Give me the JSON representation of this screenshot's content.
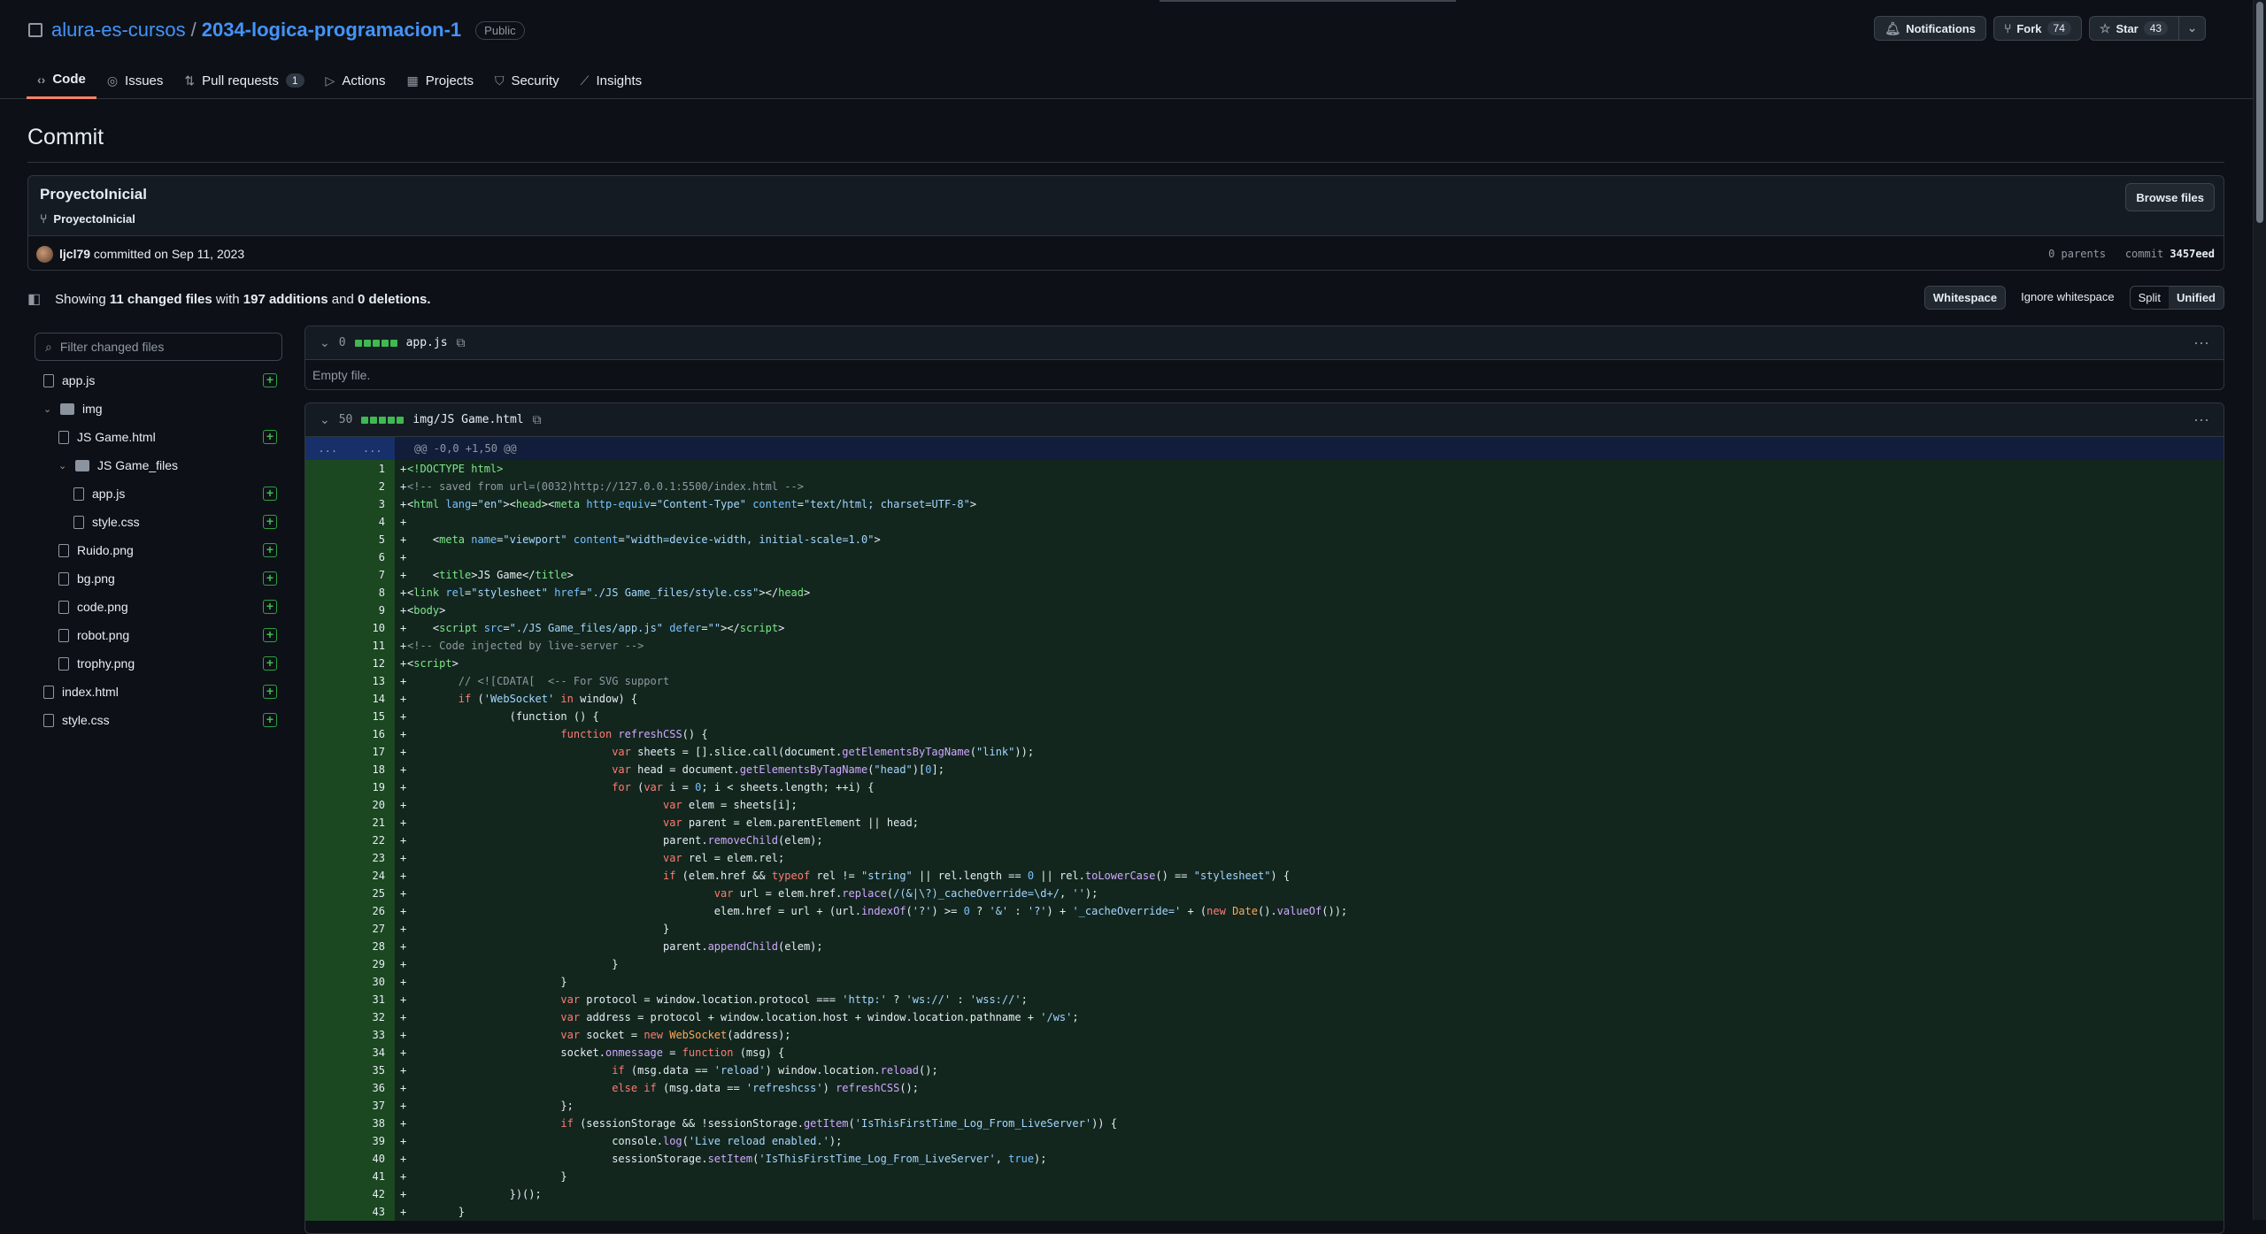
{
  "repo": {
    "owner": "alura-es-cursos",
    "name": "2034-logica-programacion-1",
    "visibility": "Public"
  },
  "header_buttons": {
    "notifications": "Notifications",
    "fork": "Fork",
    "fork_count": "74",
    "star": "Star",
    "star_count": "43"
  },
  "tabs": [
    {
      "label": "Code",
      "icon": "code-icon"
    },
    {
      "label": "Issues",
      "icon": "issue-icon"
    },
    {
      "label": "Pull requests",
      "icon": "pull-request-icon",
      "count": "1"
    },
    {
      "label": "Actions",
      "icon": "play-icon"
    },
    {
      "label": "Projects",
      "icon": "table-icon"
    },
    {
      "label": "Security",
      "icon": "shield-icon"
    },
    {
      "label": "Insights",
      "icon": "graph-icon"
    }
  ],
  "page_title": "Commit",
  "commit": {
    "title": "ProyectoInicial",
    "branch": "ProyectoInicial",
    "browse": "Browse files",
    "author": "ljcl79",
    "committed": "committed on Sep 11, 2023",
    "parents": "0 parents",
    "commit_label": "commit",
    "sha": "3457eed"
  },
  "summary": {
    "showing": "Showing",
    "files": "11 changed files",
    "with": "with",
    "additions": "197 additions",
    "and": "and",
    "deletions": "0 deletions."
  },
  "diff_options": {
    "whitespace": "Whitespace",
    "ignore": "Ignore whitespace",
    "split": "Split",
    "unified": "Unified"
  },
  "filter_placeholder": "Filter changed files",
  "tree": [
    {
      "label": "app.js",
      "type": "file",
      "depth": 0,
      "added": true
    },
    {
      "label": "img",
      "type": "folder",
      "depth": 0
    },
    {
      "label": "JS Game.html",
      "type": "file",
      "depth": 1,
      "added": true
    },
    {
      "label": "JS Game_files",
      "type": "folder",
      "depth": 1
    },
    {
      "label": "app.js",
      "type": "file",
      "depth": 2,
      "added": true
    },
    {
      "label": "style.css",
      "type": "file",
      "depth": 2,
      "added": true
    },
    {
      "label": "Ruido.png",
      "type": "file",
      "depth": 1,
      "added": true
    },
    {
      "label": "bg.png",
      "type": "file",
      "depth": 1,
      "added": true
    },
    {
      "label": "code.png",
      "type": "file",
      "depth": 1,
      "added": true
    },
    {
      "label": "robot.png",
      "type": "file",
      "depth": 1,
      "added": true
    },
    {
      "label": "trophy.png",
      "type": "file",
      "depth": 1,
      "added": true
    },
    {
      "label": "index.html",
      "type": "file",
      "depth": 0,
      "added": true
    },
    {
      "label": "style.css",
      "type": "file",
      "depth": 0,
      "added": true
    }
  ],
  "file1": {
    "count": "0",
    "path": "app.js",
    "empty": "Empty file."
  },
  "file2": {
    "count": "50",
    "path": "img/JS Game.html",
    "hunk": "@@ -0,0 +1,50 @@",
    "expand": "..."
  },
  "code_lines": [
    [
      [
        "t",
        "<!DOCTYPE html>"
      ]
    ],
    [
      [
        "c",
        "<!-- saved from url=(0032)http://127.0.0.1:5500/index.html -->"
      ]
    ],
    [
      [
        "p",
        "<"
      ],
      [
        "t",
        "html "
      ],
      [
        "a",
        "lang"
      ],
      [
        "p",
        "="
      ],
      [
        "s",
        "\"en\""
      ],
      [
        "p",
        "><"
      ],
      [
        "t",
        "head"
      ],
      [
        "p",
        "><"
      ],
      [
        "t",
        "meta "
      ],
      [
        "a",
        "http-equiv"
      ],
      [
        "p",
        "="
      ],
      [
        "s",
        "\"Content-Type\" "
      ],
      [
        "a",
        "content"
      ],
      [
        "p",
        "="
      ],
      [
        "s",
        "\"text/html; charset=UTF-8\""
      ],
      [
        "p",
        ">"
      ]
    ],
    [],
    [
      [
        "p",
        "    <"
      ],
      [
        "t",
        "meta "
      ],
      [
        "a",
        "name"
      ],
      [
        "p",
        "="
      ],
      [
        "s",
        "\"viewport\" "
      ],
      [
        "a",
        "content"
      ],
      [
        "p",
        "="
      ],
      [
        "s",
        "\"width=device-width, initial-scale=1.0\""
      ],
      [
        "p",
        ">"
      ]
    ],
    [],
    [
      [
        "p",
        "    <"
      ],
      [
        "t",
        "title"
      ],
      [
        "p",
        ">JS Game</"
      ],
      [
        "t",
        "title"
      ],
      [
        "p",
        ">"
      ]
    ],
    [
      [
        "p",
        "<"
      ],
      [
        "t",
        "link "
      ],
      [
        "a",
        "rel"
      ],
      [
        "p",
        "="
      ],
      [
        "s",
        "\"stylesheet\" "
      ],
      [
        "a",
        "href"
      ],
      [
        "p",
        "="
      ],
      [
        "s",
        "\"./JS Game_files/style.css\""
      ],
      [
        "p",
        "></"
      ],
      [
        "t",
        "head"
      ],
      [
        "p",
        ">"
      ]
    ],
    [
      [
        "p",
        "<"
      ],
      [
        "t",
        "body"
      ],
      [
        "p",
        ">"
      ]
    ],
    [
      [
        "p",
        "    <"
      ],
      [
        "t",
        "script "
      ],
      [
        "a",
        "src"
      ],
      [
        "p",
        "="
      ],
      [
        "s",
        "\"./JS Game_files/app.js\" "
      ],
      [
        "a",
        "defer"
      ],
      [
        "p",
        "="
      ],
      [
        "s",
        "\"\""
      ],
      [
        "p",
        "></"
      ],
      [
        "t",
        "script"
      ],
      [
        "p",
        ">"
      ]
    ],
    [
      [
        "c",
        "<!-- Code injected by live-server -->"
      ]
    ],
    [
      [
        "p",
        "<"
      ],
      [
        "t",
        "script"
      ],
      [
        "p",
        ">"
      ]
    ],
    [
      [
        "c",
        "        // <![CDATA[  <-- For SVG support"
      ]
    ],
    [
      [
        "k",
        "        if "
      ],
      [
        "p",
        "("
      ],
      [
        "s",
        "'WebSocket' "
      ],
      [
        "k",
        "in "
      ],
      [
        "p",
        "window) {"
      ]
    ],
    [
      [
        "p",
        "                (function () {"
      ]
    ],
    [
      [
        "k",
        "                        function "
      ],
      [
        "f",
        "refreshCSS"
      ],
      [
        "p",
        "() {"
      ]
    ],
    [
      [
        "k",
        "                                var "
      ],
      [
        "p",
        "sheets = [].slice.call(document."
      ],
      [
        "f",
        "getElementsByTagName"
      ],
      [
        "p",
        "("
      ],
      [
        "s",
        "\"link\""
      ],
      [
        "p",
        "));"
      ]
    ],
    [
      [
        "k",
        "                                var "
      ],
      [
        "p",
        "head = document."
      ],
      [
        "f",
        "getElementsByTagName"
      ],
      [
        "p",
        "("
      ],
      [
        "s",
        "\"head\""
      ],
      [
        "p",
        ")["
      ],
      [
        "n",
        "0"
      ],
      [
        "p",
        "];"
      ]
    ],
    [
      [
        "k",
        "                                for "
      ],
      [
        "p",
        "("
      ],
      [
        "k",
        "var "
      ],
      [
        "p",
        "i = "
      ],
      [
        "n",
        "0"
      ],
      [
        "p",
        "; i < sheets.length; ++i) {"
      ]
    ],
    [
      [
        "k",
        "                                        var "
      ],
      [
        "p",
        "elem = sheets[i];"
      ]
    ],
    [
      [
        "k",
        "                                        var "
      ],
      [
        "p",
        "parent = elem.parentElement || head;"
      ]
    ],
    [
      [
        "p",
        "                                        parent."
      ],
      [
        "f",
        "removeChild"
      ],
      [
        "p",
        "(elem);"
      ]
    ],
    [
      [
        "k",
        "                                        var "
      ],
      [
        "p",
        "rel = elem.rel;"
      ]
    ],
    [
      [
        "k",
        "                                        if "
      ],
      [
        "p",
        "(elem.href && "
      ],
      [
        "k",
        "typeof "
      ],
      [
        "p",
        "rel != "
      ],
      [
        "s",
        "\"string\" "
      ],
      [
        "p",
        "|| rel.length == "
      ],
      [
        "n",
        "0 "
      ],
      [
        "p",
        "|| rel."
      ],
      [
        "f",
        "toLowerCase"
      ],
      [
        "p",
        "() == "
      ],
      [
        "s",
        "\"stylesheet\""
      ],
      [
        "p",
        ") {"
      ]
    ],
    [
      [
        "k",
        "                                                var "
      ],
      [
        "p",
        "url = elem.href."
      ],
      [
        "f",
        "replace"
      ],
      [
        "p",
        "("
      ],
      [
        "s",
        "/(&|\\?)_cacheOverride=\\d+/"
      ],
      [
        "p",
        ", "
      ],
      [
        "s",
        "''"
      ],
      [
        "p",
        ");"
      ]
    ],
    [
      [
        "p",
        "                                                elem.href = url + (url."
      ],
      [
        "f",
        "indexOf"
      ],
      [
        "p",
        "("
      ],
      [
        "s",
        "'?'"
      ],
      [
        "p",
        ") >= "
      ],
      [
        "n",
        "0 "
      ],
      [
        "p",
        "? "
      ],
      [
        "s",
        "'&' "
      ],
      [
        "p",
        ": "
      ],
      [
        "s",
        "'?'"
      ],
      [
        "p",
        ") + "
      ],
      [
        "s",
        "'_cacheOverride=' "
      ],
      [
        "p",
        "+ ("
      ],
      [
        "k",
        "new "
      ],
      [
        "x",
        "Date"
      ],
      [
        "p",
        "()."
      ],
      [
        "f",
        "valueOf"
      ],
      [
        "p",
        "());"
      ]
    ],
    [
      [
        "p",
        "                                        }"
      ]
    ],
    [
      [
        "p",
        "                                        parent."
      ],
      [
        "f",
        "appendChild"
      ],
      [
        "p",
        "(elem);"
      ]
    ],
    [
      [
        "p",
        "                                }"
      ]
    ],
    [
      [
        "p",
        "                        }"
      ]
    ],
    [
      [
        "k",
        "                        var "
      ],
      [
        "p",
        "protocol = window.location.protocol === "
      ],
      [
        "s",
        "'http:' "
      ],
      [
        "p",
        "? "
      ],
      [
        "s",
        "'ws://' "
      ],
      [
        "p",
        ": "
      ],
      [
        "s",
        "'wss://'"
      ],
      [
        "p",
        ";"
      ]
    ],
    [
      [
        "k",
        "                        var "
      ],
      [
        "p",
        "address = protocol + window.location.host + window.location.pathname + "
      ],
      [
        "s",
        "'/ws'"
      ],
      [
        "p",
        ";"
      ]
    ],
    [
      [
        "k",
        "                        var "
      ],
      [
        "p",
        "socket = "
      ],
      [
        "k",
        "new "
      ],
      [
        "x",
        "WebSocket"
      ],
      [
        "p",
        "(address);"
      ]
    ],
    [
      [
        "p",
        "                        socket."
      ],
      [
        "f",
        "onmessage "
      ],
      [
        "p",
        "= "
      ],
      [
        "k",
        "function "
      ],
      [
        "p",
        "(msg) {"
      ]
    ],
    [
      [
        "k",
        "                                if "
      ],
      [
        "p",
        "(msg.data == "
      ],
      [
        "s",
        "'reload'"
      ],
      [
        "p",
        ") window.location."
      ],
      [
        "f",
        "reload"
      ],
      [
        "p",
        "();"
      ]
    ],
    [
      [
        "k",
        "                                else if "
      ],
      [
        "p",
        "(msg.data == "
      ],
      [
        "s",
        "'refreshcss'"
      ],
      [
        "p",
        ") "
      ],
      [
        "f",
        "refreshCSS"
      ],
      [
        "p",
        "();"
      ]
    ],
    [
      [
        "p",
        "                        };"
      ]
    ],
    [
      [
        "k",
        "                        if "
      ],
      [
        "p",
        "(sessionStorage && !sessionStorage."
      ],
      [
        "f",
        "getItem"
      ],
      [
        "p",
        "("
      ],
      [
        "s",
        "'IsThisFirstTime_Log_From_LiveServer'"
      ],
      [
        "p",
        ")) {"
      ]
    ],
    [
      [
        "p",
        "                                console."
      ],
      [
        "f",
        "log"
      ],
      [
        "p",
        "("
      ],
      [
        "s",
        "'Live reload enabled.'"
      ],
      [
        "p",
        ");"
      ]
    ],
    [
      [
        "p",
        "                                sessionStorage."
      ],
      [
        "f",
        "setItem"
      ],
      [
        "p",
        "("
      ],
      [
        "s",
        "'IsThisFirstTime_Log_From_LiveServer'"
      ],
      [
        "p",
        ", "
      ],
      [
        "n",
        "true"
      ],
      [
        "p",
        ");"
      ]
    ],
    [
      [
        "p",
        "                        }"
      ]
    ],
    [
      [
        "p",
        "                })();"
      ]
    ],
    [
      [
        "p",
        "        }"
      ]
    ]
  ],
  "colors": {
    "accent": "#4493f8",
    "added": "#3fb950",
    "tab_underline": "#f78166"
  }
}
